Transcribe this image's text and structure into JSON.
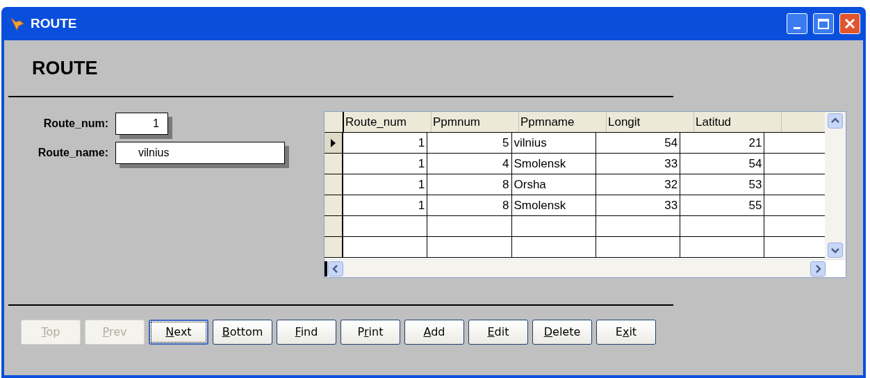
{
  "window": {
    "title": "ROUTE"
  },
  "heading": "ROUTE",
  "fields": [
    {
      "label": "Route_num:",
      "value": "1"
    },
    {
      "label": "Route_name:",
      "value": "vilnius"
    }
  ],
  "grid": {
    "columns": [
      {
        "label": "Route_num"
      },
      {
        "label": "Ppmnum"
      },
      {
        "label": "Ppmname"
      },
      {
        "label": "Longit"
      },
      {
        "label": "Latitud"
      }
    ],
    "rows": [
      {
        "selected": true,
        "cells": [
          "1",
          "5",
          "vilnius",
          "54",
          "21"
        ]
      },
      {
        "selected": false,
        "cells": [
          "1",
          "4",
          "Smolensk",
          "33",
          "54"
        ]
      },
      {
        "selected": false,
        "cells": [
          "1",
          "8",
          "Orsha",
          "32",
          "53"
        ]
      },
      {
        "selected": false,
        "cells": [
          "1",
          "8",
          "Smolensk",
          "33",
          "55"
        ]
      },
      {
        "selected": false
      },
      {
        "selected": false
      }
    ]
  },
  "buttons": [
    {
      "key": "T",
      "post": "op",
      "disabled": true,
      "focused": false
    },
    {
      "key": "P",
      "post": "rev",
      "disabled": true,
      "focused": false
    },
    {
      "key": "N",
      "post": "ext",
      "disabled": false,
      "focused": true
    },
    {
      "key": "B",
      "post": "ottom",
      "disabled": false,
      "focused": false
    },
    {
      "key": "F",
      "post": "ind",
      "disabled": false,
      "focused": false
    },
    {
      "pre": "P",
      "key": "r",
      "post": "int",
      "disabled": false,
      "focused": false
    },
    {
      "key": "A",
      "post": "dd",
      "disabled": false,
      "focused": false
    },
    {
      "key": "E",
      "post": "dit",
      "disabled": false,
      "focused": false
    },
    {
      "key": "D",
      "post": "elete",
      "disabled": false,
      "focused": false
    },
    {
      "pre": "E",
      "key": "x",
      "post": "it",
      "disabled": false,
      "focused": false
    }
  ]
}
